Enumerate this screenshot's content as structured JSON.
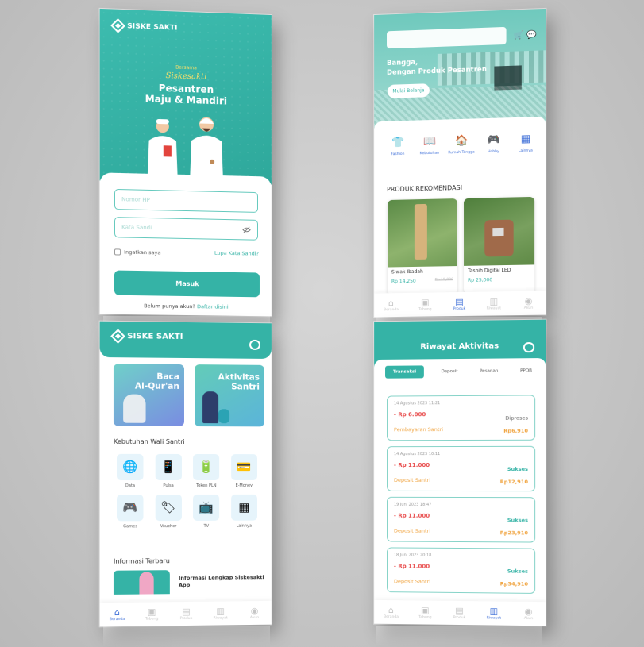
{
  "brand": {
    "name": "SISKE SAKTI"
  },
  "login": {
    "hero_small": "Bersama",
    "hero_script": "Siskesakti",
    "hero_title_line1": "Pesantren",
    "hero_title_line2": "Maju & Mandiri",
    "phone_placeholder": "Nomor HP",
    "password_placeholder": "Kata Sandi",
    "remember_label": "Ingatkan saya",
    "forgot_label": "Lupa Kata Sandi?",
    "submit_label": "Masuk",
    "register_prompt": "Belum punya akun?",
    "register_link": "Daftar disini"
  },
  "shop": {
    "tagline_line1": "Bangga,",
    "tagline_line2": "Dengan Produk Pesantren",
    "cta_label": "Mulai Belanja",
    "categories": [
      {
        "label": "Fashion",
        "icon": "shirt-icon",
        "glyph": "👕"
      },
      {
        "label": "Kebutuhan",
        "icon": "book-icon",
        "glyph": "📖"
      },
      {
        "label": "Rumah Tangga",
        "icon": "home-goods-icon",
        "glyph": "🏠"
      },
      {
        "label": "Hobby",
        "icon": "gamepad-icon",
        "glyph": "🎮"
      },
      {
        "label": "Lainnya",
        "icon": "grid-icon",
        "glyph": "▦"
      }
    ],
    "section_title": "PRODUK REKOMENDASI",
    "products": [
      {
        "name": "Siwak Ibadah",
        "price": "Rp 14,250",
        "old_price": "Rp 15,000"
      },
      {
        "name": "Tasbih Digital LED",
        "price": "Rp 25,000",
        "old_price": ""
      }
    ],
    "nav": [
      {
        "label": "Beranda",
        "icon": "home-icon",
        "glyph": "⌂",
        "active": false
      },
      {
        "label": "Tabung",
        "icon": "wallet-icon",
        "glyph": "▣",
        "active": false
      },
      {
        "label": "Produk",
        "icon": "store-icon",
        "glyph": "▤",
        "active": true
      },
      {
        "label": "Riwayat",
        "icon": "history-icon",
        "glyph": "▥",
        "active": false
      },
      {
        "label": "Akun",
        "icon": "user-icon",
        "glyph": "◉",
        "active": false
      }
    ]
  },
  "home": {
    "banner1_line1": "Baca",
    "banner1_line2": "Al-Qur'an",
    "banner2_line1": "Aktivitas",
    "banner2_line2": "Santri",
    "services_title": "Kebutuhan Wali Santri",
    "services": [
      {
        "label": "Data",
        "icon": "globe-icon",
        "glyph": "🌐"
      },
      {
        "label": "Pulsa",
        "icon": "phone-icon",
        "glyph": "📱"
      },
      {
        "label": "Token PLN",
        "icon": "token-icon",
        "glyph": "🔋"
      },
      {
        "label": "E-Money",
        "icon": "emoney-icon",
        "glyph": "💳"
      },
      {
        "label": "Games",
        "icon": "games-icon",
        "glyph": "🎮"
      },
      {
        "label": "Voucher",
        "icon": "voucher-icon",
        "glyph": "🏷"
      },
      {
        "label": "TV",
        "icon": "tv-icon",
        "glyph": "📺"
      },
      {
        "label": "Lainnya",
        "icon": "more-icon",
        "glyph": "▦"
      }
    ],
    "news_title": "Informasi Terbaru",
    "news_item": "Informasi Lengkap Siskesakti App",
    "nav": [
      {
        "label": "Beranda",
        "icon": "home-icon",
        "glyph": "⌂",
        "active": true
      },
      {
        "label": "Tabung",
        "icon": "wallet-icon",
        "glyph": "▣",
        "active": false
      },
      {
        "label": "Produk",
        "icon": "store-icon",
        "glyph": "▤",
        "active": false
      },
      {
        "label": "Riwayat",
        "icon": "history-icon",
        "glyph": "▥",
        "active": false
      },
      {
        "label": "Akun",
        "icon": "user-icon",
        "glyph": "◉",
        "active": false
      }
    ]
  },
  "history": {
    "title": "Riwayat Aktivitas",
    "tabs": [
      {
        "label": "Transaksi",
        "active": true
      },
      {
        "label": "Deposit",
        "active": false
      },
      {
        "label": "Pesanan",
        "active": false
      },
      {
        "label": "PPOB",
        "active": false
      }
    ],
    "transactions": [
      {
        "date": "14 Agustus 2023 11:21",
        "amount": "- Rp 6.000",
        "status": "Diproses",
        "desc": "Pembayaran Santri",
        "balance": "Rp6,910"
      },
      {
        "date": "14 Agustus 2023 10:11",
        "amount": "- Rp 11.000",
        "status": "Sukses",
        "desc": "Deposit Santri",
        "balance": "Rp12,910"
      },
      {
        "date": "19 Juni 2023 18:47",
        "amount": "- Rp 11.000",
        "status": "Sukses",
        "desc": "Deposit Santri",
        "balance": "Rp23,910"
      },
      {
        "date": "18 Juni 2023 20:18",
        "amount": "- Rp 11.000",
        "status": "Sukses",
        "desc": "Deposit Santri",
        "balance": "Rp34,910"
      }
    ],
    "nav": [
      {
        "label": "Beranda",
        "icon": "home-icon",
        "glyph": "⌂",
        "active": false
      },
      {
        "label": "Tabung",
        "icon": "wallet-icon",
        "glyph": "▣",
        "active": false
      },
      {
        "label": "Produk",
        "icon": "store-icon",
        "glyph": "▤",
        "active": false
      },
      {
        "label": "Riwayat",
        "icon": "history-icon",
        "glyph": "▥",
        "active": true
      },
      {
        "label": "Akun",
        "icon": "user-icon",
        "glyph": "◉",
        "active": false
      }
    ]
  },
  "colors": {
    "primary": "#35b3a6",
    "accent_blue": "#3e6fd8",
    "debit": "#e84b4b",
    "highlight": "#f0a440"
  }
}
